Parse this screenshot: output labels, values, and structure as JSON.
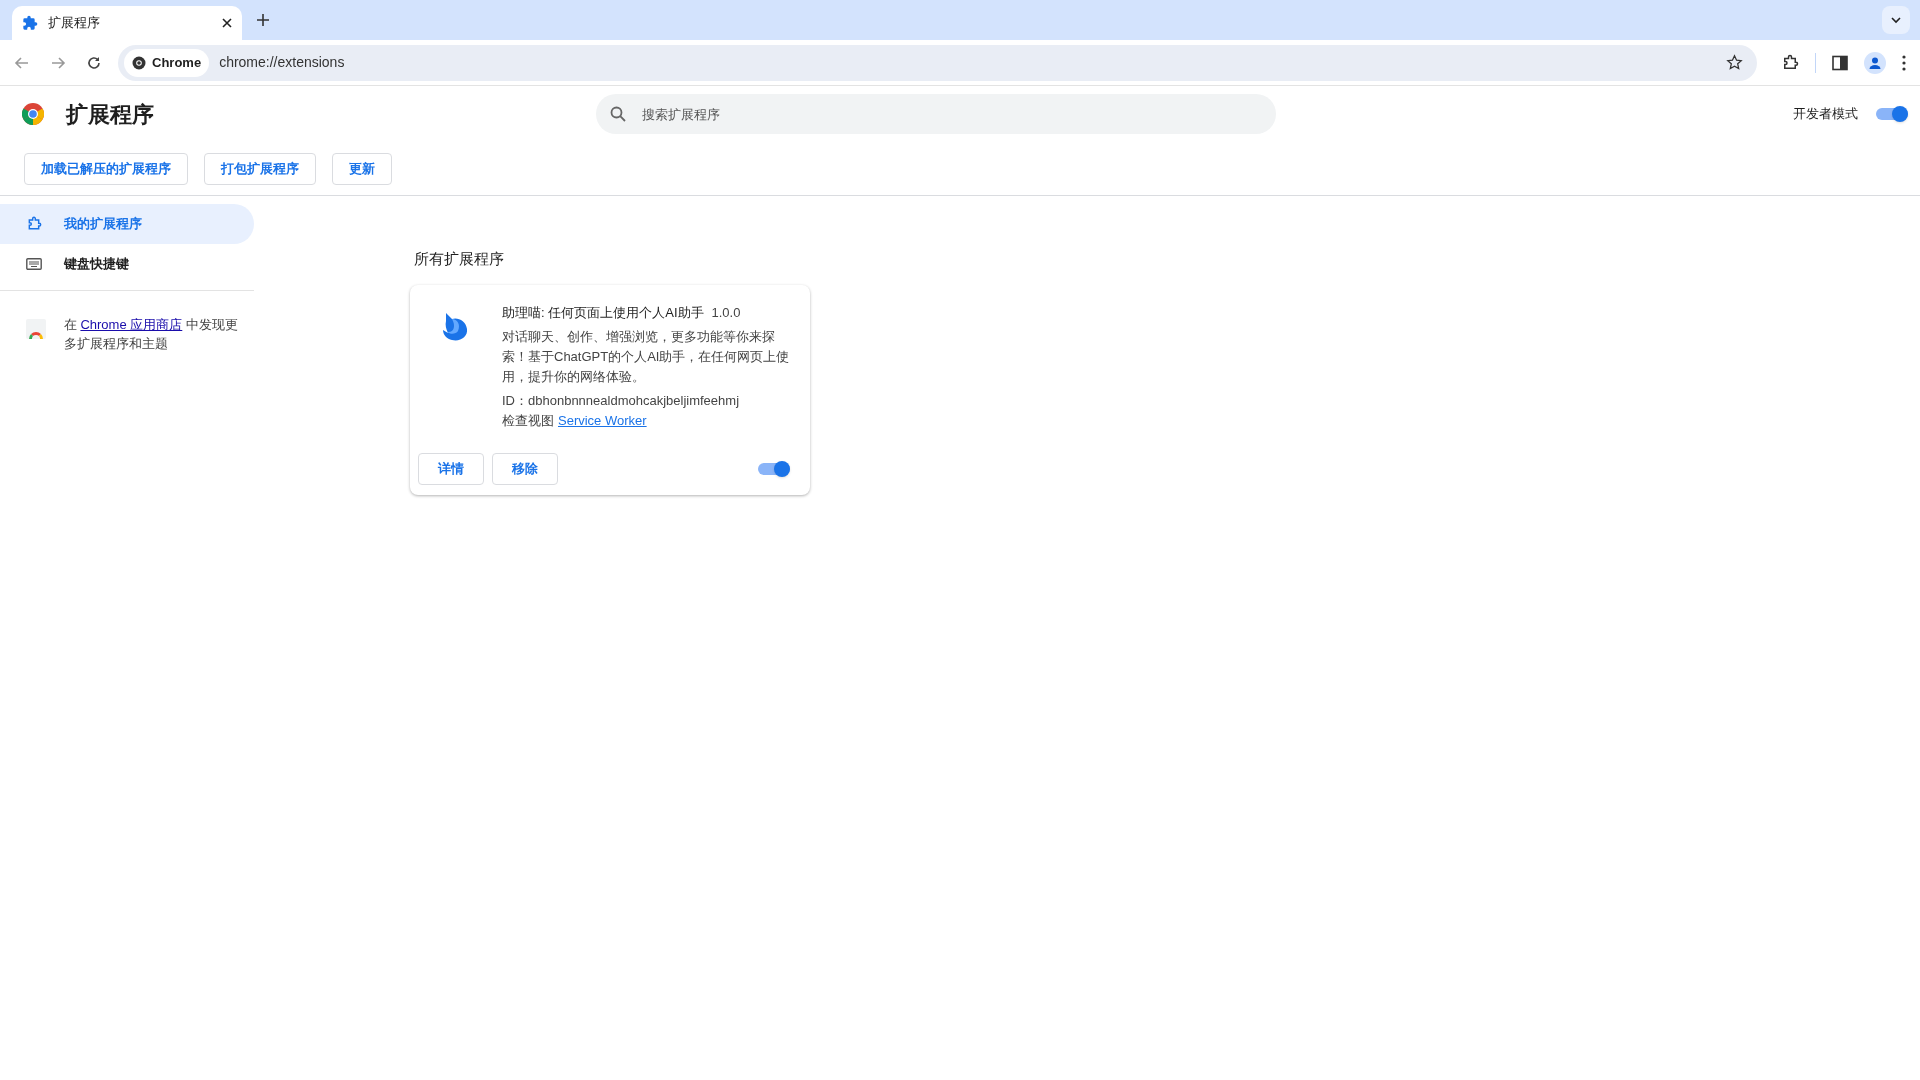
{
  "browser": {
    "tab": {
      "title": "扩展程序",
      "selected": true
    },
    "site_chip": "Chrome",
    "address": "chrome://extensions"
  },
  "header": {
    "title": "扩展程序",
    "search": {
      "placeholder": "搜索扩展程序"
    },
    "developer_mode": {
      "label": "开发者模式",
      "on": true
    }
  },
  "toolbar_buttons": [
    "加载已解压的扩展程序",
    "打包扩展程序",
    "更新"
  ],
  "sidebar": {
    "items": [
      {
        "label": "我的扩展程序",
        "kind": "extensions",
        "selected": true
      },
      {
        "label": "键盘快捷键",
        "kind": "keyboard",
        "selected": false
      }
    ],
    "store_promo": {
      "prefix": "在 ",
      "link": "Chrome 应用商店",
      "suffix": " 中发现更多扩展程序和主题"
    }
  },
  "section_title": "所有扩展程序",
  "extensions": [
    {
      "name": "助理喵: 任何页面上使用个人AI助手",
      "version": "1.0.0",
      "description": "对话聊天、创作、增强浏览，更多功能等你来探索！基于ChatGPT的个人AI助手，在任何网页上使用，提升你的网络体验。",
      "id": "ID：dbhonbnnnealdmohcakjbeljimfeehmj",
      "inspect_label": "检查视图",
      "inspect_link": "Service Worker",
      "buttons": [
        "详情",
        "移除"
      ],
      "on": true
    }
  ]
}
